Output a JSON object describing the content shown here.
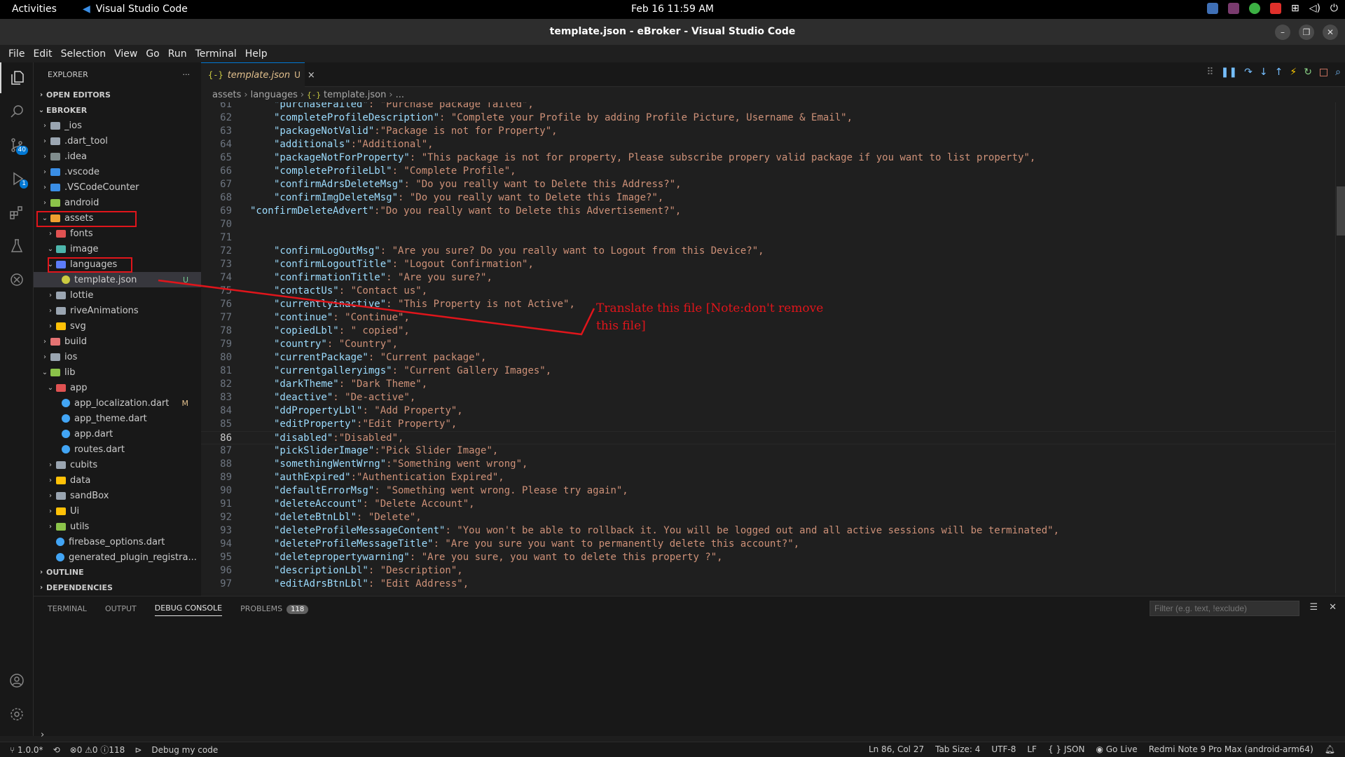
{
  "gnome": {
    "activities": "Activities",
    "app_name": "Visual Studio Code",
    "clock": "Feb 16  11:59 AM"
  },
  "window": {
    "title": "template.json - eBroker - Visual Studio Code"
  },
  "menu": [
    "File",
    "Edit",
    "Selection",
    "View",
    "Go",
    "Run",
    "Terminal",
    "Help"
  ],
  "activity": {
    "scm_badge": "40",
    "debug_badge": "1"
  },
  "sidebar": {
    "title": "EXPLORER",
    "more": "···",
    "open_editors": "OPEN EDITORS",
    "project": "EBROKER",
    "outline": "OUTLINE",
    "dependencies": "DEPENDENCIES",
    "tree": [
      {
        "label": "_ios",
        "chev": "›",
        "color": "#9aa5b1"
      },
      {
        "label": ".dart_tool",
        "chev": "›",
        "color": "#9aa5b1"
      },
      {
        "label": ".idea",
        "chev": "›",
        "color": "#7f8c8d"
      },
      {
        "label": ".vscode",
        "chev": "›",
        "color": "#3a8ee6"
      },
      {
        "label": ".VSCodeCounter",
        "chev": "›",
        "color": "#3a8ee6"
      },
      {
        "label": "android",
        "chev": "›",
        "color": "#8bc34a"
      },
      {
        "label": "assets",
        "chev": "⌄",
        "color": "#f0a030"
      },
      {
        "label": "fonts",
        "chev": "›",
        "color": "#e05252"
      },
      {
        "label": "image",
        "chev": "⌄",
        "color": "#4db6ac"
      },
      {
        "label": "languages",
        "chev": "⌄",
        "color": "#5c7cfa"
      },
      {
        "label": "template.json",
        "chev": "",
        "color": "#cbcb41",
        "deco": "U"
      },
      {
        "label": "lottie",
        "chev": "›",
        "color": "#9aa5b1"
      },
      {
        "label": "riveAnimations",
        "chev": "›",
        "color": "#9aa5b1"
      },
      {
        "label": "svg",
        "chev": "›",
        "color": "#ffc107"
      },
      {
        "label": "build",
        "chev": "›",
        "color": "#e57373"
      },
      {
        "label": "ios",
        "chev": "›",
        "color": "#9aa5b1"
      },
      {
        "label": "lib",
        "chev": "⌄",
        "color": "#8bc34a"
      },
      {
        "label": "app",
        "chev": "⌄",
        "color": "#e05252"
      },
      {
        "label": "app_localization.dart",
        "chev": "",
        "color": "#42a5f5",
        "deco": "M"
      },
      {
        "label": "app_theme.dart",
        "chev": "",
        "color": "#42a5f5"
      },
      {
        "label": "app.dart",
        "chev": "",
        "color": "#42a5f5"
      },
      {
        "label": "routes.dart",
        "chev": "",
        "color": "#42a5f5"
      },
      {
        "label": "cubits",
        "chev": "›",
        "color": "#9aa5b1"
      },
      {
        "label": "data",
        "chev": "›",
        "color": "#ffc107"
      },
      {
        "label": "sandBox",
        "chev": "›",
        "color": "#9aa5b1"
      },
      {
        "label": "Ui",
        "chev": "›",
        "color": "#ffc107"
      },
      {
        "label": "utils",
        "chev": "›",
        "color": "#8bc34a"
      },
      {
        "label": "firebase_options.dart",
        "chev": "",
        "color": "#42a5f5"
      },
      {
        "label": "generated_plugin_registra...",
        "chev": "",
        "color": "#42a5f5"
      }
    ]
  },
  "tab": {
    "icon": "{-}",
    "label": "template.json",
    "status": "U",
    "close": "×"
  },
  "breadcrumb": [
    "assets",
    "languages",
    "template.json",
    "..."
  ],
  "editor": {
    "lines": [
      {
        "n": "61",
        "k": "\"purchaseFailed\"",
        "v": ": \"Purchase package failed\","
      },
      {
        "n": "62",
        "k": "\"completeProfileDescription\"",
        "v": ": \"Complete your Profile by adding Profile Picture, Username & Email\","
      },
      {
        "n": "63",
        "k": "\"packageNotValid\"",
        "v": ":\"Package is not for Property\","
      },
      {
        "n": "64",
        "k": "\"additionals\"",
        "v": ":\"Additional\","
      },
      {
        "n": "65",
        "k": "\"packageNotForProperty\"",
        "v": ": \"This package is not for property, Please subscribe propery valid package if you want to list property\","
      },
      {
        "n": "66",
        "k": "\"completeProfileLbl\"",
        "v": ": \"Complete Profile\","
      },
      {
        "n": "67",
        "k": "\"confirmAdrsDeleteMsg\"",
        "v": ": \"Do you really want to Delete this Address?\","
      },
      {
        "n": "68",
        "k": "\"confirmImgDeleteMsg\"",
        "v": ": \"Do you really want to Delete this Image?\","
      },
      {
        "n": "69",
        "k": "\"confirmDeleteAdvert\"",
        "v": ":\"Do you really want to Delete this Advertisement?\",",
        "outdent": true
      },
      {
        "n": "70",
        "k": "",
        "v": ""
      },
      {
        "n": "71",
        "k": "",
        "v": ""
      },
      {
        "n": "72",
        "k": "\"confirmLogOutMsg\"",
        "v": ": \"Are you sure? Do you really want to Logout from this Device?\","
      },
      {
        "n": "73",
        "k": "\"confirmLogoutTitle\"",
        "v": ": \"Logout Confirmation\","
      },
      {
        "n": "74",
        "k": "\"confirmationTitle\"",
        "v": ": \"Are you sure?\","
      },
      {
        "n": "75",
        "k": "\"contactUs\"",
        "v": ": \"Contact us\","
      },
      {
        "n": "76",
        "k": "\"currentlyinactive\"",
        "v": ": \"This Property is not Active\","
      },
      {
        "n": "77",
        "k": "\"continue\"",
        "v": ": \"Continue\","
      },
      {
        "n": "78",
        "k": "\"copiedLbl\"",
        "v": ": \" copied\","
      },
      {
        "n": "79",
        "k": "\"country\"",
        "v": ": \"Country\","
      },
      {
        "n": "80",
        "k": "\"currentPackage\"",
        "v": ": \"Current package\","
      },
      {
        "n": "81",
        "k": "\"currentgalleryimgs\"",
        "v": ": \"Current Gallery Images\","
      },
      {
        "n": "82",
        "k": "\"darkTheme\"",
        "v": ": \"Dark Theme\","
      },
      {
        "n": "83",
        "k": "\"deactive\"",
        "v": ": \"De-active\","
      },
      {
        "n": "84",
        "k": "\"ddPropertyLbl\"",
        "v": ": \"Add Property\","
      },
      {
        "n": "85",
        "k": "\"editProperty\"",
        "v": ":\"Edit Property\","
      },
      {
        "n": "86",
        "k": "\"disabled\"",
        "v": ":\"Disabled\",",
        "current": true
      },
      {
        "n": "87",
        "k": "\"pickSliderImage\"",
        "v": ":\"Pick Slider Image\","
      },
      {
        "n": "88",
        "k": "\"somethingWentWrng\"",
        "v": ":\"Something went wrong\","
      },
      {
        "n": "89",
        "k": "\"authExpired\"",
        "v": ":\"Authentication Expired\","
      },
      {
        "n": "90",
        "k": "\"defaultErrorMsg\"",
        "v": ": \"Something went wrong. Please try again\","
      },
      {
        "n": "91",
        "k": "\"deleteAccount\"",
        "v": ": \"Delete Account\","
      },
      {
        "n": "92",
        "k": "\"deleteBtnLbl\"",
        "v": ": \"Delete\","
      },
      {
        "n": "93",
        "k": "\"deleteProfileMessageContent\"",
        "v": ": \"You won't be able to rollback it. You will be logged out and all active sessions will be terminated\","
      },
      {
        "n": "94",
        "k": "\"deleteProfileMessageTitle\"",
        "v": ": \"Are you sure you want to permanently delete this account?\","
      },
      {
        "n": "95",
        "k": "\"deletepropertywarning\"",
        "v": ": \"Are you sure, you want to delete this property ?\","
      },
      {
        "n": "96",
        "k": "\"descriptionLbl\"",
        "v": ": \"Description\","
      },
      {
        "n": "97",
        "k": "\"editAdrsBtnLbl\"",
        "v": ": \"Edit Address\","
      }
    ]
  },
  "annotation": {
    "text": "Translate this file [Note:don't remove this file]"
  },
  "panel": {
    "tabs": [
      "TERMINAL",
      "OUTPUT",
      "DEBUG CONSOLE",
      "PROBLEMS"
    ],
    "problems_count": "118",
    "filter_placeholder": "Filter (e.g. text, !exclude)",
    "prompt": "›"
  },
  "status": {
    "branch": "1.0.0*",
    "errors": "0",
    "warnings": "0",
    "info": "118",
    "debug": "Debug my code",
    "position": "Ln 86, Col 27",
    "tab_size": "Tab Size: 4",
    "encoding": "UTF-8",
    "eol": "LF",
    "language": "JSON",
    "golive": "Go Live",
    "device": "Redmi Note 9 Pro Max (android-arm64)"
  },
  "colors": {
    "accent": "#0078d4",
    "annotation_red": "#e0151b"
  }
}
